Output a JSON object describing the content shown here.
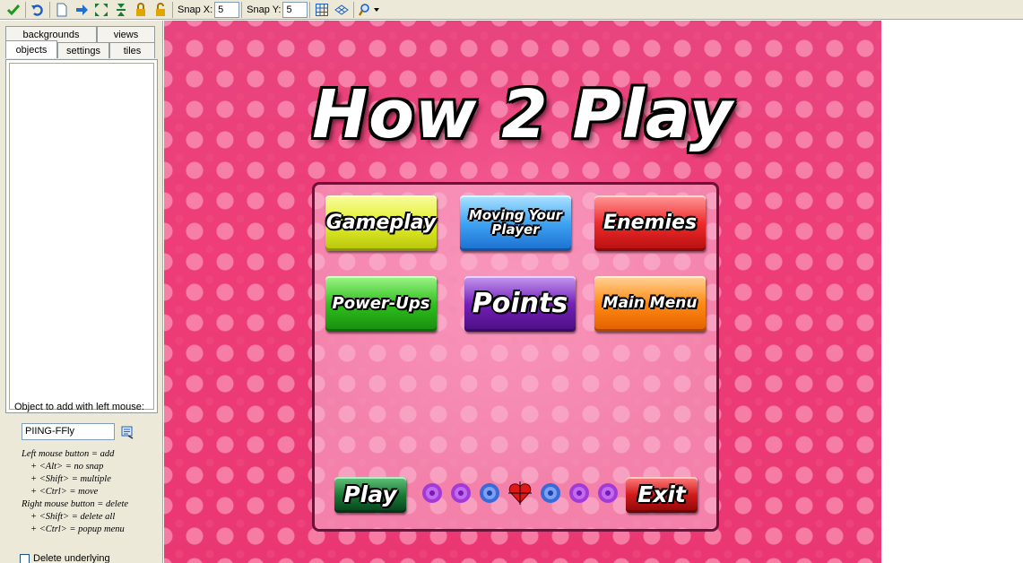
{
  "toolbar": {
    "icons": [
      "check-icon",
      "undo-icon",
      "new-document-icon",
      "shift-right-icon",
      "expand-icon",
      "vertical-expand-icon",
      "lock-icon",
      "unlock-icon",
      "grid-icon",
      "isometric-grid-icon",
      "zoom-icon"
    ],
    "snap_x_label": "Snap X:",
    "snap_x_value": "5",
    "snap_y_label": "Snap Y:",
    "snap_y_value": "5"
  },
  "tabs": {
    "row1": [
      "backgrounds",
      "views"
    ],
    "row2": [
      "objects",
      "settings",
      "tiles"
    ],
    "active": "objects"
  },
  "object_panel": {
    "title": "Object to add with left mouse:",
    "value": "PIING-FFly",
    "help": [
      {
        "text": "Left mouse button = add",
        "indent": false
      },
      {
        "text": "+ <Alt> = no snap",
        "indent": true
      },
      {
        "text": "+ <Shift> = multiple",
        "indent": true
      },
      {
        "text": "+ <Ctrl> = move",
        "indent": true
      },
      {
        "text": "Right mouse button = delete",
        "indent": false
      },
      {
        "text": "+ <Shift> = delete all",
        "indent": true
      },
      {
        "text": "+ <Ctrl> = popup menu",
        "indent": true
      }
    ],
    "checkbox_label": "Delete underlying"
  },
  "room": {
    "title": "How 2 Play",
    "buttons": {
      "gameplay": "Gameplay",
      "moving_line1": "Moving Your",
      "moving_line2": "Player",
      "enemies": "Enemies",
      "power_ups": "Power-Ups",
      "points": "Points",
      "main_menu": "Main Menu",
      "play": "Play",
      "exit": "Exit"
    },
    "roses": [
      "purple",
      "purple",
      "blue",
      "heart",
      "blue",
      "purple",
      "purple"
    ],
    "colors": {
      "accent": "#ea3773",
      "panel_border": "#6b1236"
    }
  }
}
